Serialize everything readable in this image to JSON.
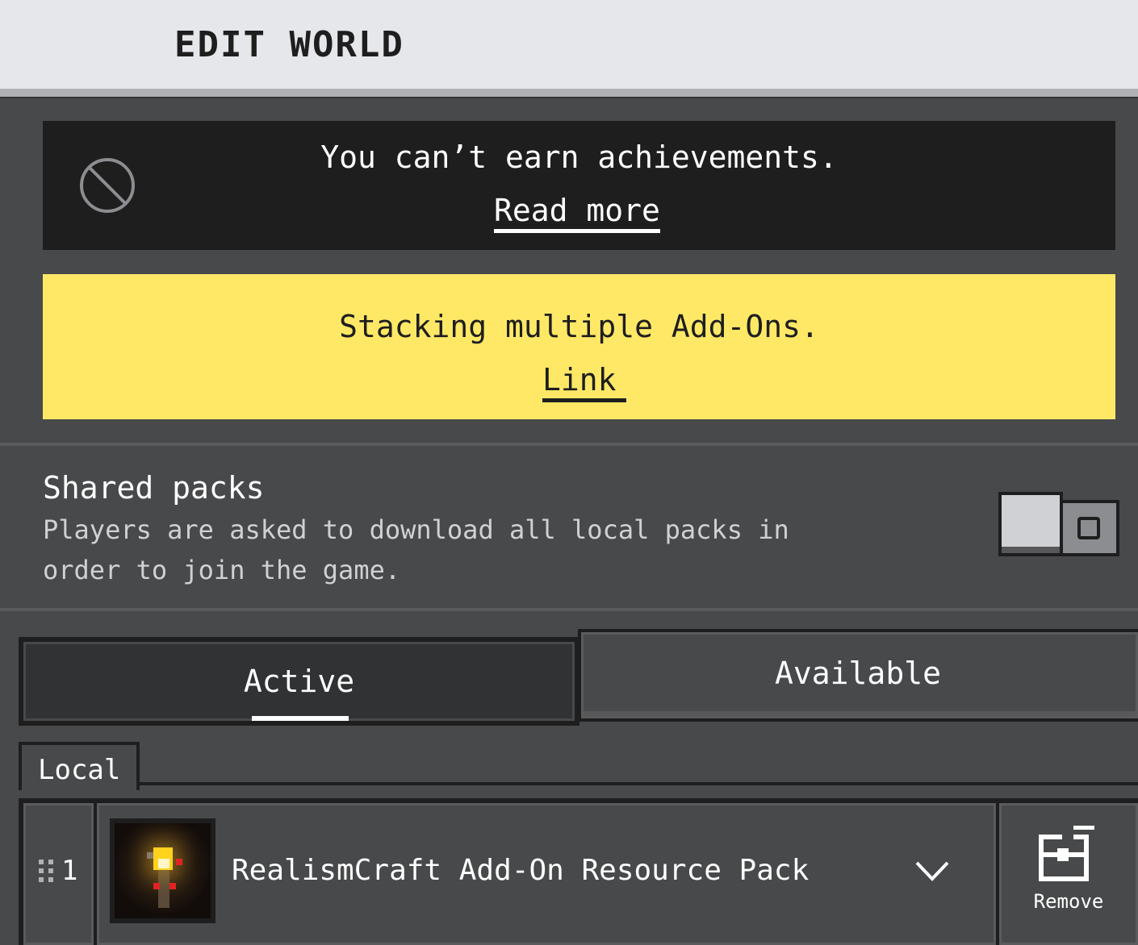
{
  "header": {
    "title": "EDIT WORLD"
  },
  "achievements_banner": {
    "icon": "ban-icon",
    "message": "You can’t earn achievements.",
    "link_label": "Read more"
  },
  "warning_banner": {
    "message": "Stacking multiple Add-Ons.",
    "link_label": "Link",
    "color": "#ffe866"
  },
  "shared_packs": {
    "title": "Shared packs",
    "description": "Players are asked to download all local packs in order to join the game.",
    "toggle_on": false
  },
  "tabs": [
    {
      "label": "Active",
      "selected": true
    },
    {
      "label": "Available",
      "selected": false
    }
  ],
  "section": {
    "label": "Local"
  },
  "packs": [
    {
      "index": "1",
      "name": "RealismCraft Add-On Resource Pack",
      "thumbnail_icon": "torch-icon",
      "expand_icon": "chevron-down-icon",
      "remove_icon": "remove-pack-icon",
      "remove_label": "Remove"
    }
  ],
  "colors": {
    "header_bg": "#e6e7ea",
    "body_bg": "#48494a",
    "dark_panel": "#1e1e1f",
    "warning_yellow": "#ffe866"
  }
}
